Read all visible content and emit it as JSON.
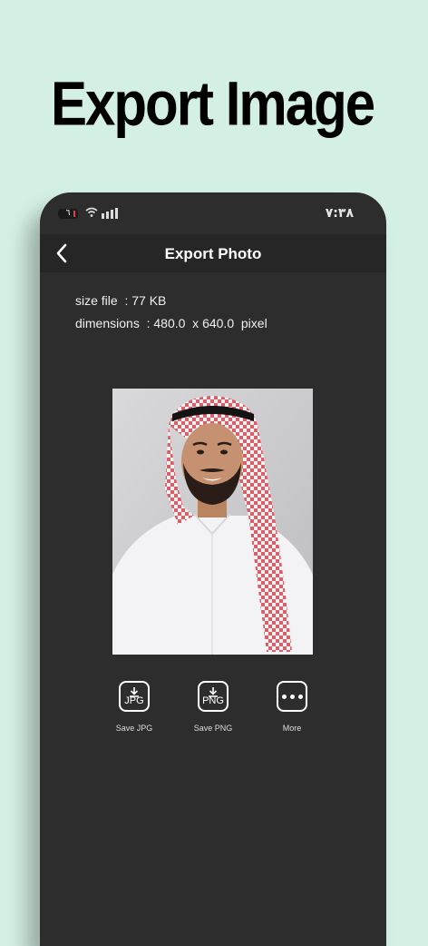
{
  "promo": {
    "headline": "Export Image"
  },
  "status_bar": {
    "battery_level": "٦",
    "time": "٧:٣٨"
  },
  "nav": {
    "title": "Export Photo",
    "back_icon": "chevron-left-icon"
  },
  "info": {
    "size_line": "size file  : 77 KB",
    "dimensions_line": "dimensions  : 480.0  x 640.0  pixel"
  },
  "photo": {
    "description_icon": "portrait-photo"
  },
  "actions": [
    {
      "ext": "JPG",
      "label": "Save JPG",
      "icon": "download-jpg-icon"
    },
    {
      "ext": "PNG",
      "label": "Save PNG",
      "icon": "download-png-icon"
    },
    {
      "label": "More",
      "icon": "more-icon"
    }
  ],
  "colors": {
    "background": "#d4efe4",
    "phone": "#2d2d2d",
    "navbar": "#262626"
  }
}
